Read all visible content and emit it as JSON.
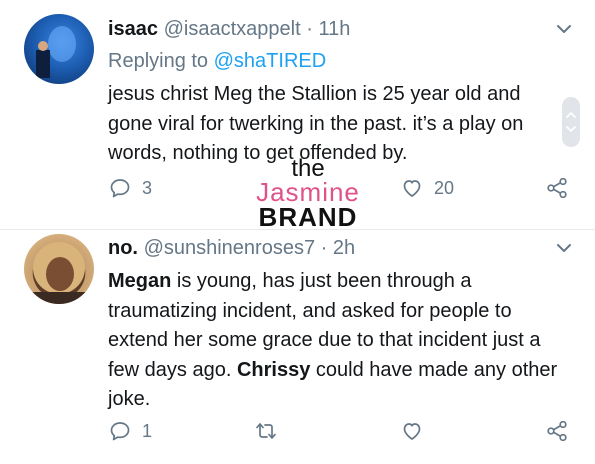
{
  "tweet1": {
    "name": "isaac",
    "handle": "@isaactxappelt",
    "separator": "·",
    "time": "11h",
    "replying_prefix": "Replying to",
    "replying_to": "@shaTIRED",
    "text": "jesus christ Meg the Stallion is 25 year old and gone viral for twerking in the past. it’s a play on words, nothing to get offended by.",
    "reply_count": "3",
    "like_count": "20"
  },
  "tweet2": {
    "name": "no.",
    "handle": "@sunshinenroses7",
    "separator": "·",
    "time": "2h",
    "text_part1_bold": "Megan",
    "text_part2": " is young, has just been through a traumatizing incident, and asked for people to extend her some grace due to that incident just a few days ago. ",
    "text_part3_bold": "Chrissy",
    "text_part4": " could have made any other joke.",
    "reply_count": "1"
  },
  "watermark": {
    "line1": "the",
    "line2": "Jasmine",
    "line3": "BRAND"
  },
  "colors": {
    "accent": "#1da1f2",
    "muted": "#657786",
    "text": "#14171a",
    "watermark_pink": "#e0528a"
  },
  "icons": {
    "reply": "reply-icon",
    "retweet": "retweet-icon",
    "like": "heart-icon",
    "share": "share-icon",
    "more": "chevron-down-icon"
  }
}
